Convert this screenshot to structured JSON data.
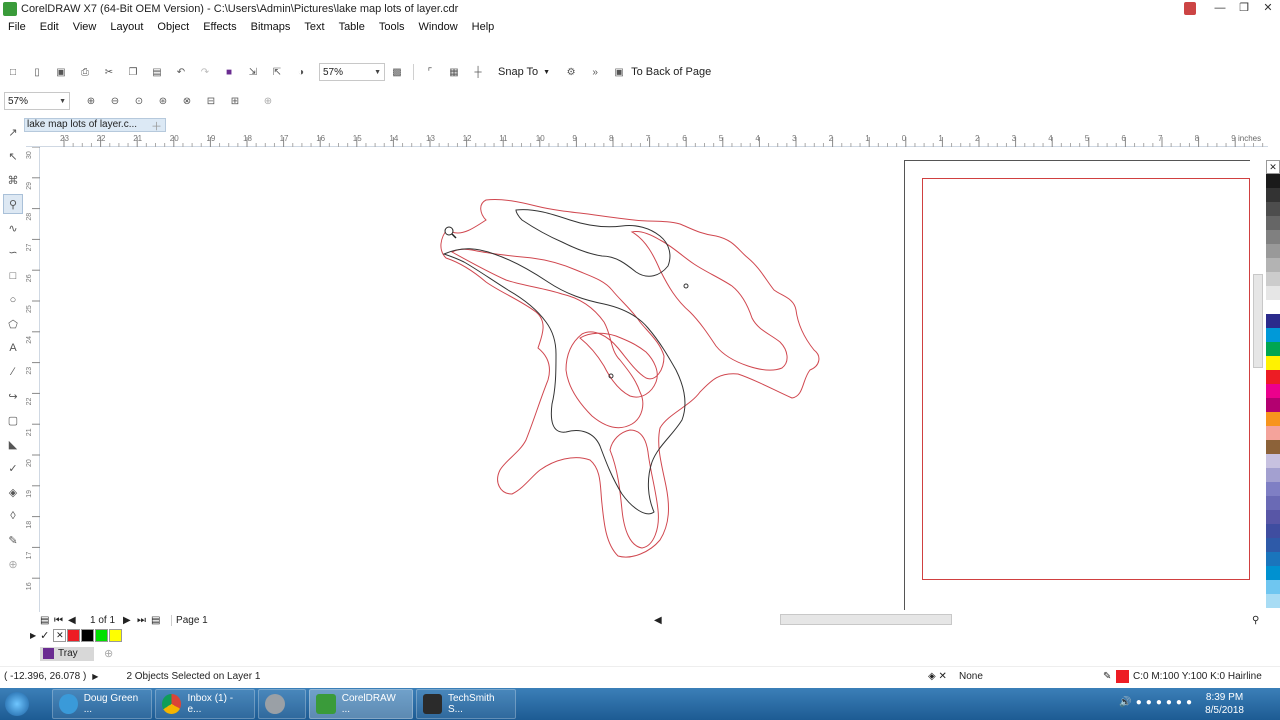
{
  "window": {
    "title": "CorelDRAW X7 (64-Bit OEM Version) - C:\\Users\\Admin\\Pictures\\lake map lots of layer.cdr"
  },
  "menu": [
    "File",
    "Edit",
    "View",
    "Layout",
    "Object",
    "Effects",
    "Bitmaps",
    "Text",
    "Table",
    "Tools",
    "Window",
    "Help"
  ],
  "toolbar": {
    "zoom": "57%",
    "snap_to": "Snap To",
    "to_back": "To Back of Page"
  },
  "toolbar2": {
    "zoom": "57%"
  },
  "doc_tab": {
    "label": "lake map lots of layer.c..."
  },
  "ruler": {
    "unit": "inches",
    "h_ticks": [
      "23",
      "22",
      "21",
      "20",
      "19",
      "18",
      "17",
      "16",
      "15",
      "14",
      "13",
      "12",
      "11",
      "10",
      "9",
      "8",
      "7",
      "6",
      "5",
      "4",
      "3",
      "2",
      "1",
      "0",
      "1",
      "2",
      "3",
      "4",
      "5",
      "6",
      "7",
      "8",
      "9"
    ],
    "v_ticks": [
      "30",
      "29",
      "28",
      "27",
      "26",
      "25",
      "24",
      "23",
      "22",
      "21",
      "20",
      "19",
      "18",
      "17",
      "16"
    ]
  },
  "navigator": {
    "page_count": "1 of 1",
    "page_tab": "Page 1"
  },
  "tray": {
    "label": "Tray"
  },
  "status": {
    "coords": "( -12.396, 26.078 )",
    "selection": "2 Objects Selected on Layer 1",
    "fill": "None",
    "outline": "C:0 M:100 Y:100 K:0  Hairline"
  },
  "taskbar": {
    "items": [
      "Doug Green ...",
      "Inbox (1) - e...",
      "",
      "CorelDRAW ...",
      "TechSmith S..."
    ],
    "time": "8:39 PM",
    "date": "8/5/2018"
  },
  "colors": {
    "contour_red": "#d0474f",
    "contour_dark": "#333333",
    "palette": [
      "#ffffff",
      "#1a1a1a",
      "#333333",
      "#4d4d4d",
      "#666666",
      "#808080",
      "#999999",
      "#b3b3b3",
      "#cccccc",
      "#e6e6e6",
      "#ffffff",
      "#2b2b8c",
      "#0099d8",
      "#00a651",
      "#fff200",
      "#ed1c24",
      "#ec008c",
      "#b30070",
      "#f7941d",
      "#f4a39b",
      "#8c6239",
      "#c7c1e0",
      "#a3a0d0",
      "#7f7fc4",
      "#6a6ab5",
      "#5856a6",
      "#3f4da0",
      "#2e5aa8",
      "#1a75bc",
      "#0091d0",
      "#6fc6f0",
      "#a8dcf4"
    ]
  }
}
